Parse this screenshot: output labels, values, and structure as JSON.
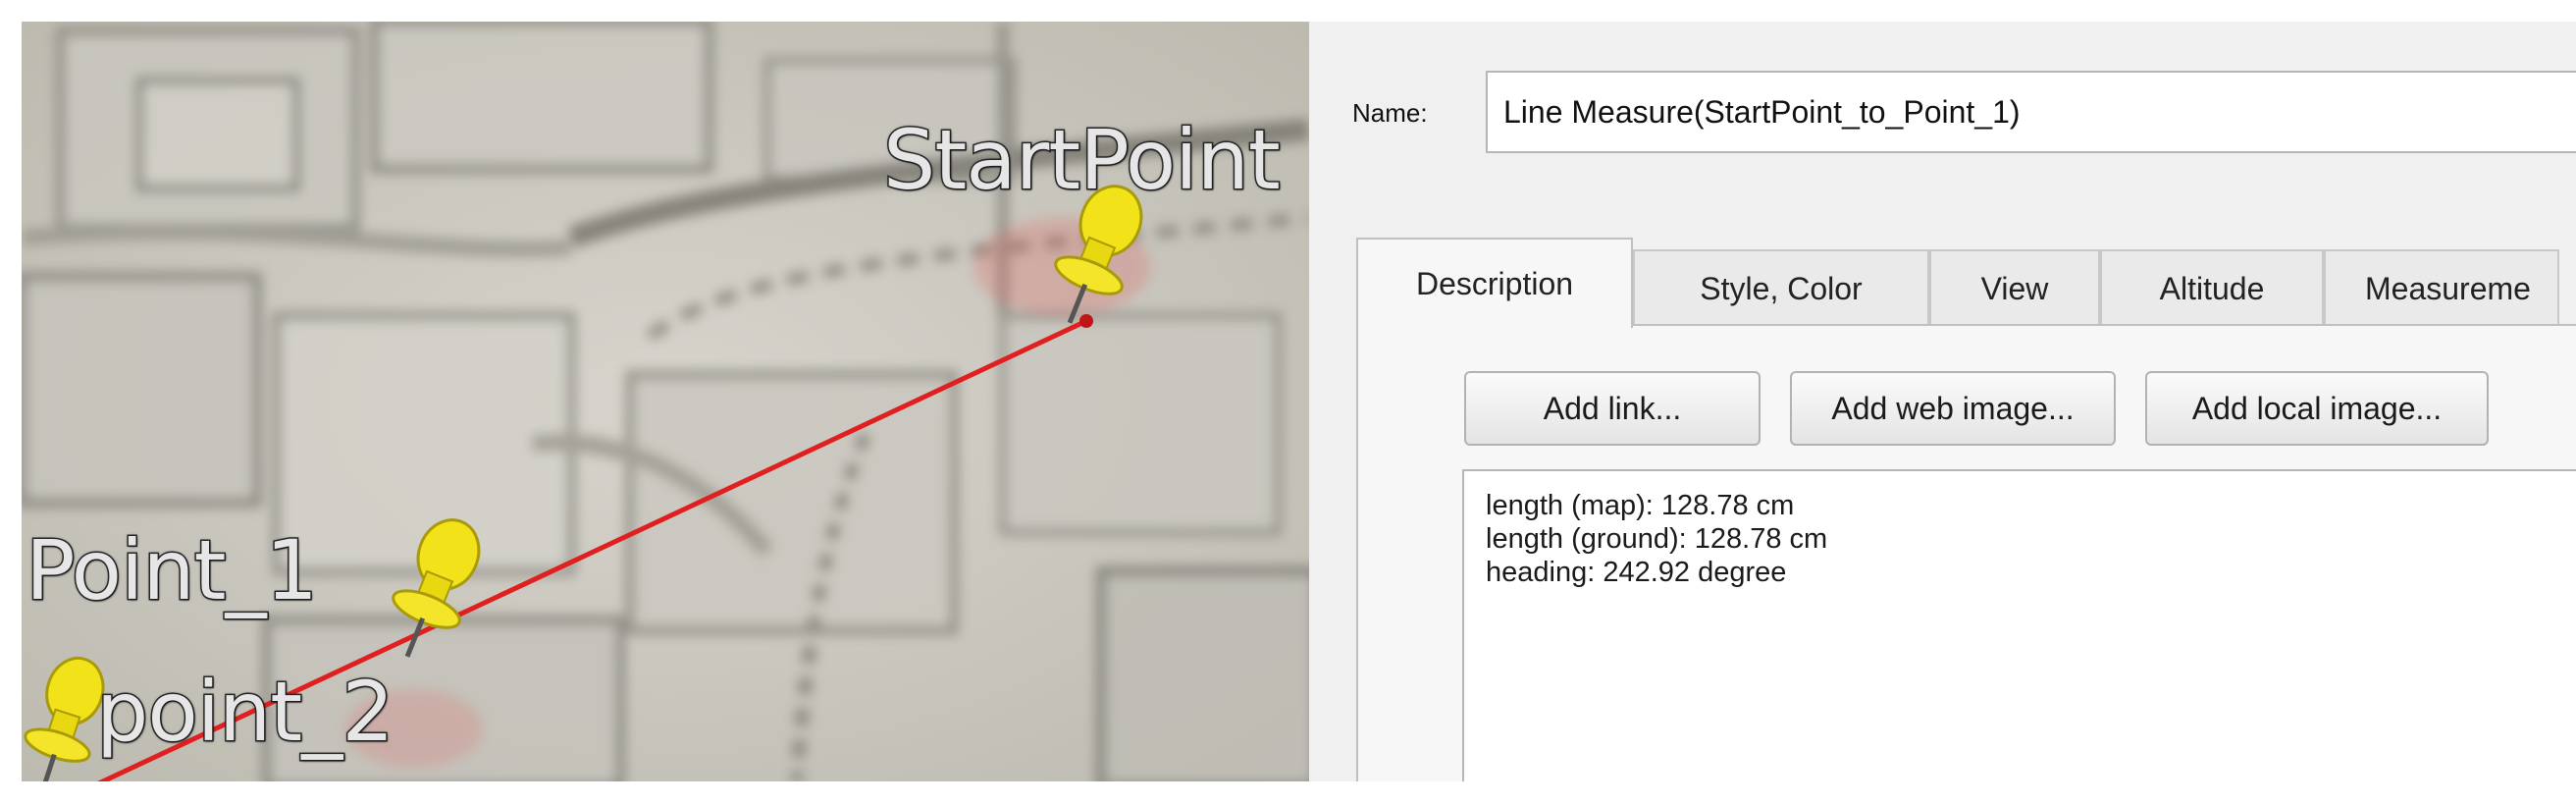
{
  "map": {
    "placemarks": [
      {
        "label": "StartPoint"
      },
      {
        "label": "Point_1"
      },
      {
        "label": "point_2"
      }
    ],
    "measure_line_color": "#e02020",
    "pin_color": "#f2e21a"
  },
  "dialog": {
    "name_label": "Name:",
    "name_value": "Line Measure(StartPoint_to_Point_1)",
    "tabs": [
      {
        "label": "Description",
        "active": true
      },
      {
        "label": "Style, Color",
        "active": false
      },
      {
        "label": "View",
        "active": false
      },
      {
        "label": "Altitude",
        "active": false
      },
      {
        "label": "Measureme",
        "active": false
      }
    ],
    "buttons": {
      "add_link": "Add link...",
      "add_web_image": "Add web image...",
      "add_local_image": "Add local image..."
    },
    "description_lines": [
      "length (map): 128.78 cm",
      "length (ground): 128.78 cm",
      "heading: 242.92 degree"
    ]
  }
}
